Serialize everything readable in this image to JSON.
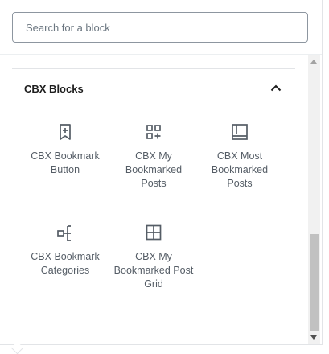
{
  "search": {
    "placeholder": "Search for a block",
    "value": ""
  },
  "panel": {
    "title": "CBX Blocks",
    "blocks": [
      {
        "label": "CBX Bookmark Button",
        "icon": "bookmark-plus-icon"
      },
      {
        "label": "CBX My Bookmarked Posts",
        "icon": "blocks-add-icon"
      },
      {
        "label": "CBX Most Bookmarked Posts",
        "icon": "book-icon"
      },
      {
        "label": "CBX Bookmark Categories",
        "icon": "hierarchy-icon"
      },
      {
        "label": "CBX My Bookmarked Post Grid",
        "icon": "grid-icon"
      }
    ]
  },
  "colors": {
    "text": "#1e1e1e",
    "muted": "#555d66",
    "border": "#8d96a0"
  }
}
